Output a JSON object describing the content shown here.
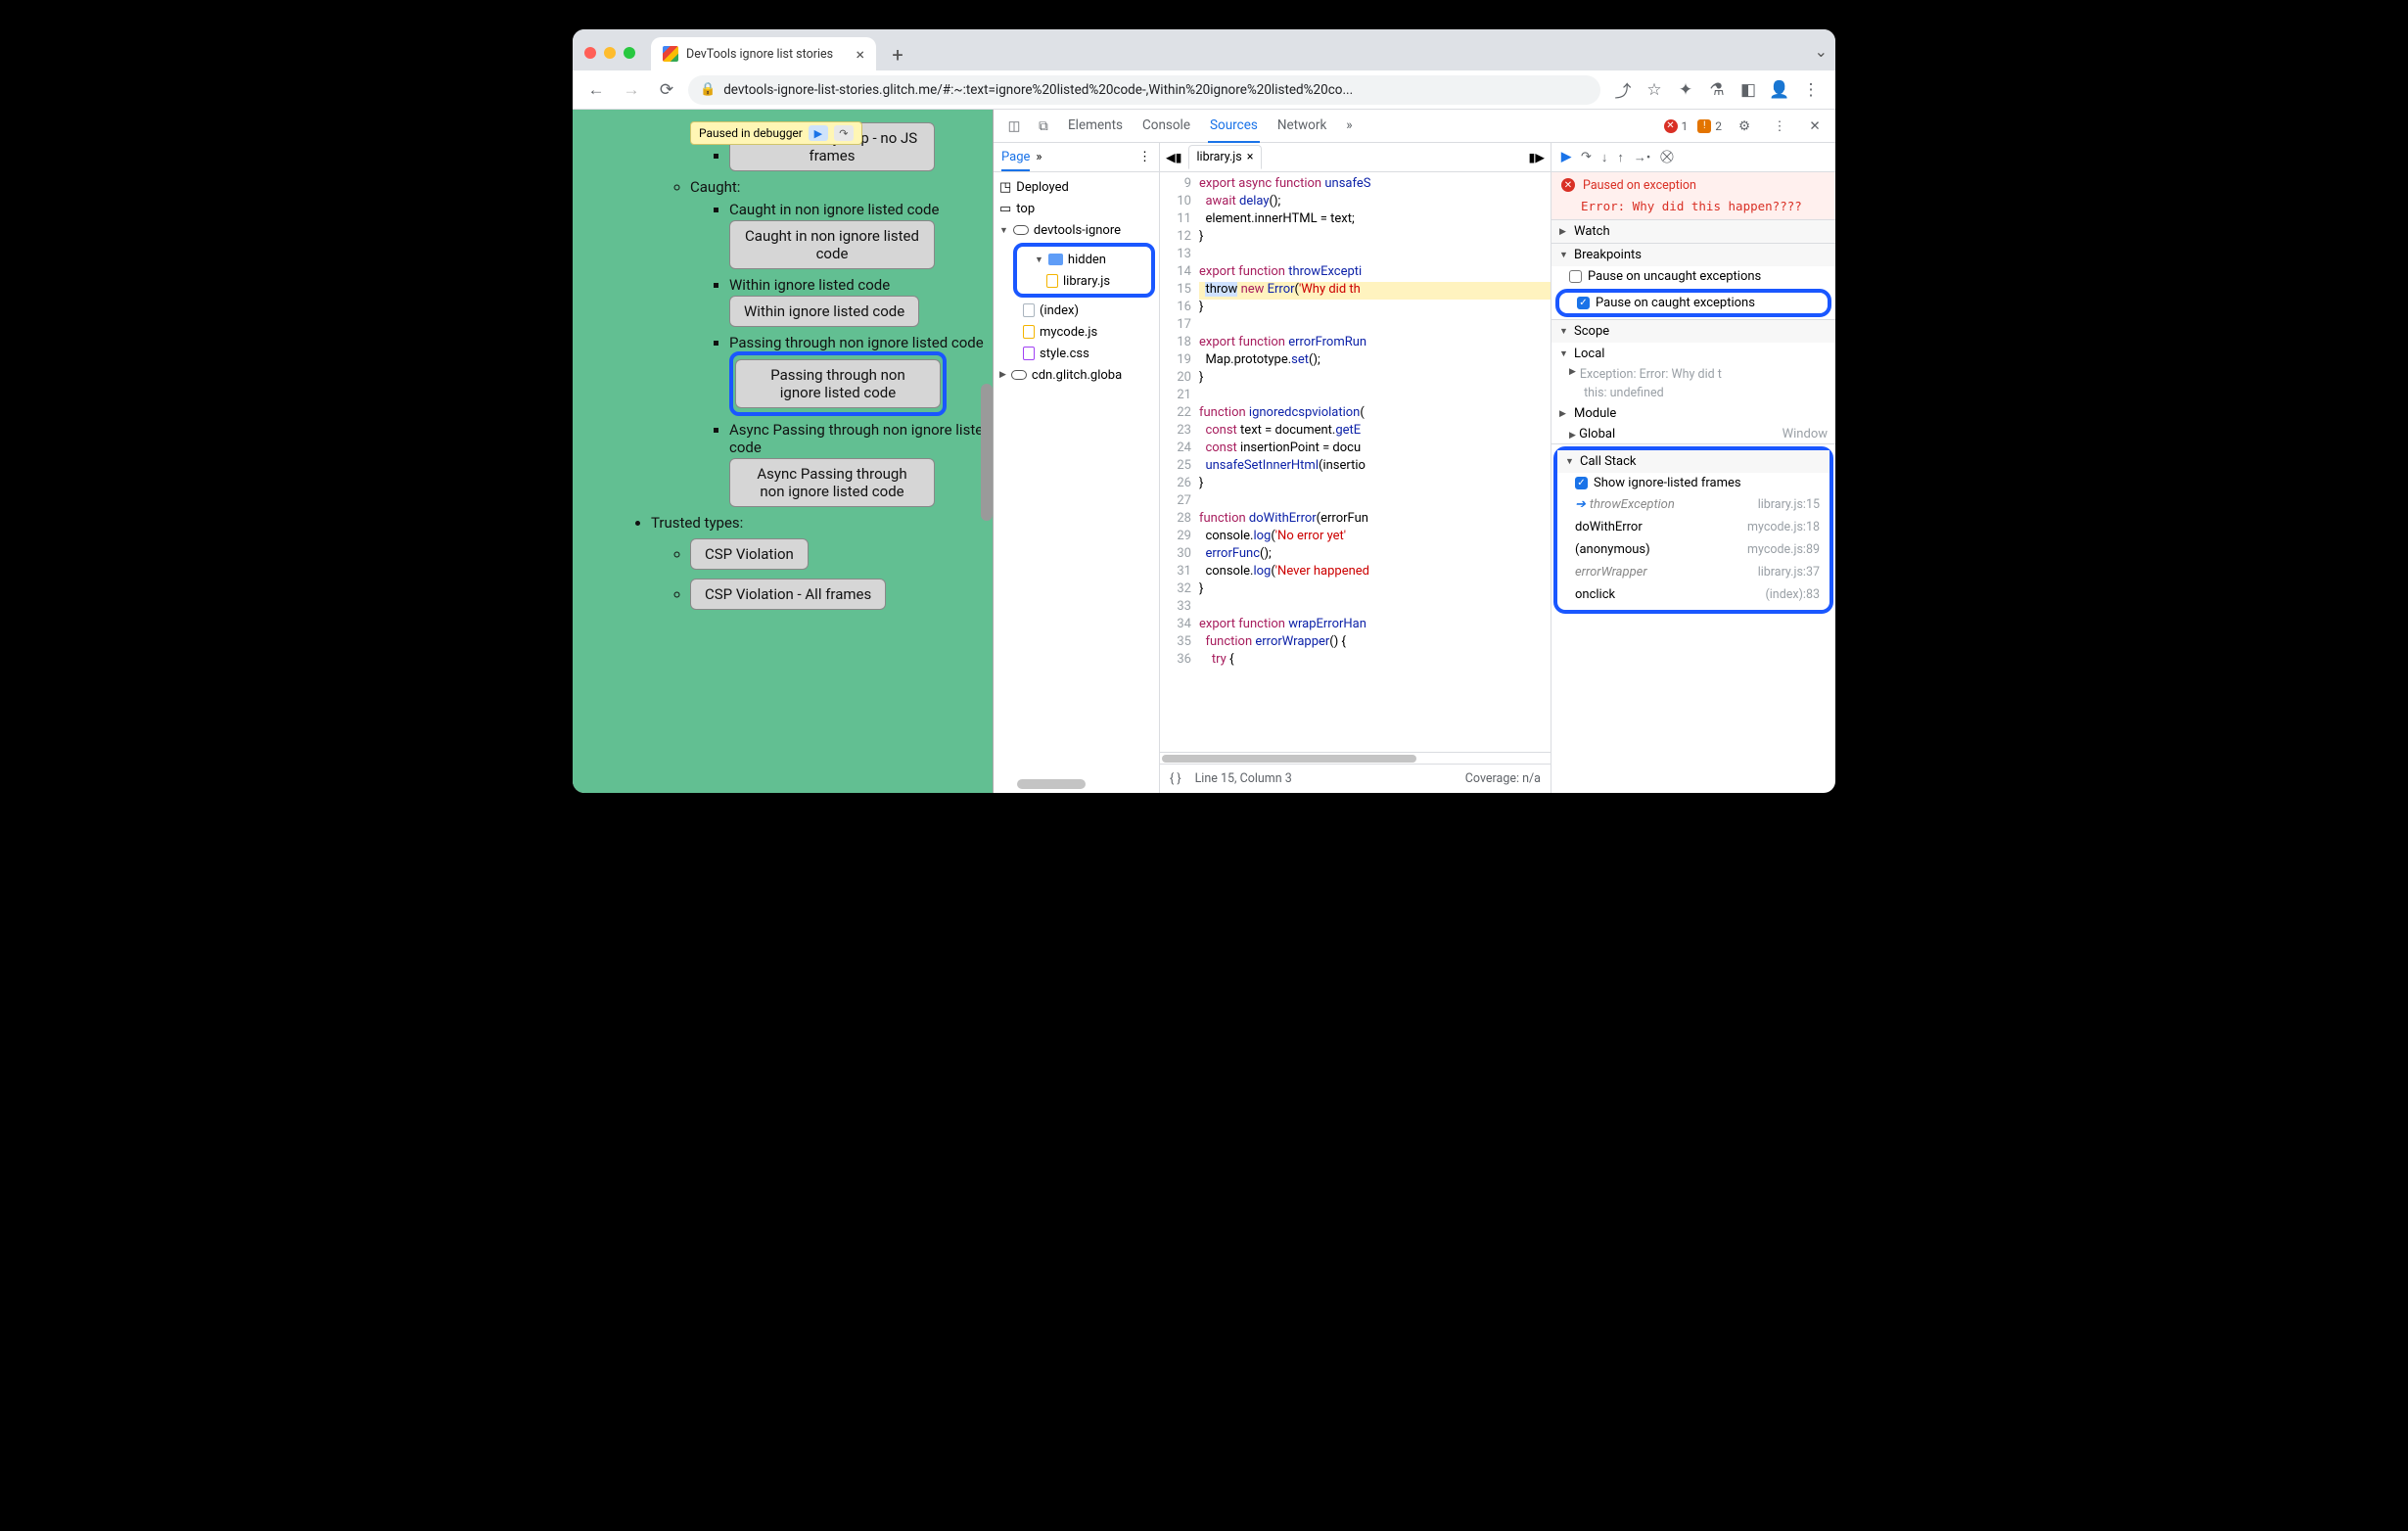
{
  "window": {
    "tab_title": "DevTools ignore list stories",
    "url": "devtools-ignore-list-stories.glitch.me/#:~:text=ignore%20listed%20code-,Within%20ignore%20listed%20co..."
  },
  "pause_pill": {
    "label": "Paused in debugger"
  },
  "page": {
    "trap_btn": "WebAssembly trap - no JS frames",
    "caught_label": "Caught:",
    "items": [
      {
        "label": "Caught in non ignore listed code",
        "btn": "Caught in non ignore listed code"
      },
      {
        "label": "Within ignore listed code",
        "btn": "Within ignore listed code"
      },
      {
        "label": "Passing through non ignore listed code",
        "btn": "Passing through non ignore listed code",
        "highlight": true
      },
      {
        "label": "Async Passing through non ignore listed code",
        "btn": "Async Passing through non ignore listed code"
      }
    ],
    "trusted_types_label": "Trusted types:",
    "trusted": [
      {
        "btn": "CSP Violation"
      },
      {
        "btn": "CSP Violation - All frames"
      }
    ]
  },
  "devtools": {
    "tabs": [
      "Elements",
      "Console",
      "Sources",
      "Network"
    ],
    "active_tab": "Sources",
    "errors": "1",
    "warnings": "2",
    "nav": {
      "page_label": "Page",
      "deployed": "Deployed",
      "top": "top",
      "origin": "devtools-ignore",
      "hidden": "hidden",
      "library": "library.js",
      "index": "(index)",
      "mycode": "mycode.js",
      "style": "style.css",
      "cdn": "cdn.glitch.globa"
    },
    "editor": {
      "filename": "library.js",
      "status_line": "Line 15, Column 3",
      "status_coverage": "Coverage: n/a",
      "first_line": 9,
      "code": [
        {
          "html": "<span class='kw'>export</span> <span class='kw'>async</span> <span class='kw'>function</span> <span class='fn'>unsafeS</span>"
        },
        {
          "html": "  <span class='kw'>await</span> <span class='fn'>delay</span>();"
        },
        {
          "html": "  element.innerHTML = text;"
        },
        {
          "html": "}"
        },
        {
          "html": ""
        },
        {
          "html": "<span class='kw'>export</span> <span class='kw'>function</span> <span class='fn'>throwExcepti</span>"
        },
        {
          "html": "  <span class='sel'>throw</span> <span class='kw'>new</span> <span class='fn'>Error</span>(<span class='str'>'Why did th</span>",
          "hl": true
        },
        {
          "html": "}"
        },
        {
          "html": ""
        },
        {
          "html": "<span class='kw'>export</span> <span class='kw'>function</span> <span class='fn'>errorFromRun</span>"
        },
        {
          "html": "  Map.prototype.<span class='fn'>set</span>();"
        },
        {
          "html": "}"
        },
        {
          "html": ""
        },
        {
          "html": "<span class='kw'>function</span> <span class='fn'>ignoredcspviolation</span>("
        },
        {
          "html": "  <span class='kw'>const</span> text = document.<span class='fn'>getE</span>"
        },
        {
          "html": "  <span class='kw'>const</span> insertionPoint = docu"
        },
        {
          "html": "  <span class='fn'>unsafeSetInnerHtml</span>(insertio"
        },
        {
          "html": "}"
        },
        {
          "html": ""
        },
        {
          "html": "<span class='kw'>function</span> <span class='fn'>doWithError</span>(errorFun"
        },
        {
          "html": "  console.<span class='fn'>log</span>(<span class='str'>'No error yet'</span>"
        },
        {
          "html": "  <span class='fn'>errorFunc</span>();"
        },
        {
          "html": "  console.<span class='fn'>log</span>(<span class='str'>'Never happened</span>"
        },
        {
          "html": "}"
        },
        {
          "html": ""
        },
        {
          "html": "<span class='kw'>export</span> <span class='kw'>function</span> <span class='fn'>wrapErrorHan</span>"
        },
        {
          "html": "  <span class='kw'>function</span> <span class='fn'>errorWrapper</span>() {"
        },
        {
          "html": "    <span class='kw'>try</span> {"
        }
      ]
    },
    "debug": {
      "banner_title": "Paused on exception",
      "banner_msg": "Error: Why did this happen????",
      "watch": "Watch",
      "breakpoints": "Breakpoints",
      "pause_uncaught": "Pause on uncaught exceptions",
      "pause_caught": "Pause on caught exceptions",
      "scope": "Scope",
      "local": "Local",
      "exception_row": "Exception: Error: Why did t",
      "this_row": "this: undefined",
      "module": "Module",
      "global": "Global",
      "window": "Window",
      "callstack": "Call Stack",
      "show_ignored": "Show ignore-listed frames",
      "frames": [
        {
          "name": "throwException",
          "loc": "library.js:15",
          "ital": true,
          "current": true
        },
        {
          "name": "doWithError",
          "loc": "mycode.js:18"
        },
        {
          "name": "(anonymous)",
          "loc": "mycode.js:89"
        },
        {
          "name": "errorWrapper",
          "loc": "library.js:37",
          "ital": true
        },
        {
          "name": "onclick",
          "loc": "(index):83"
        }
      ]
    }
  }
}
